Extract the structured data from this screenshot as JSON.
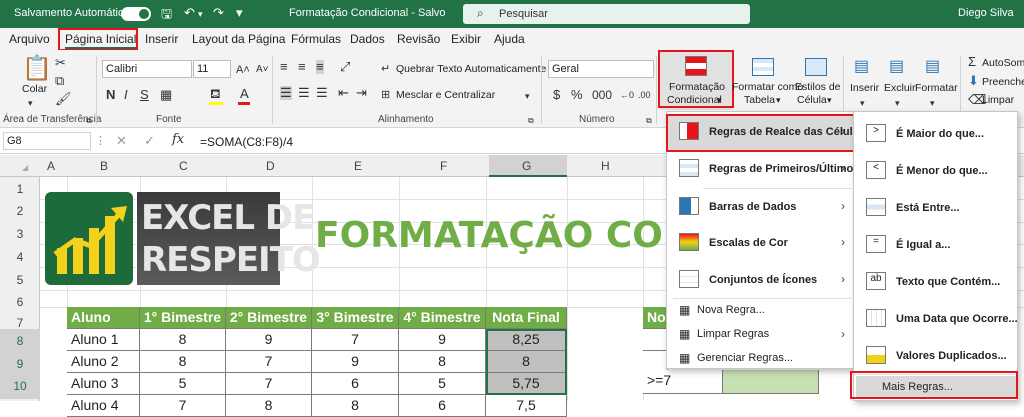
{
  "titlebar": {
    "autosave": "Salvamento Automático",
    "title": "Formatação Condicional  -  Salvo",
    "search_placeholder": "Pesquisar",
    "user": "Diego Silva"
  },
  "menu": [
    "Arquivo",
    "Página Inicial",
    "Inserir",
    "Layout da Página",
    "Fórmulas",
    "Dados",
    "Revisão",
    "Exibir",
    "Ajuda"
  ],
  "ribbon": {
    "paste": "Colar",
    "clipboard": "Área de Transferência",
    "font_name": "Calibri",
    "font_size": "11",
    "font_group": "Fonte",
    "wrap": "Quebrar Texto Automaticamente",
    "merge": "Mesclar e Centralizar",
    "alignment": "Alinhamento",
    "number_format": "Geral",
    "number_group": "Número",
    "cond_format_1": "Formatação",
    "cond_format_2": "Condicional",
    "format_table_1": "Formatar como",
    "format_table_2": "Tabela",
    "cell_styles_1": "Estilos de",
    "cell_styles_2": "Célula",
    "insert": "Inserir",
    "delete": "Excluir",
    "format": "Formatar",
    "autosum": "AutoSoma",
    "fill": "Preencher",
    "clear": "Limpar"
  },
  "formula": {
    "namebox": "G8",
    "fx": "fx",
    "value": "=SOMA(C8:F8)/4"
  },
  "columns": [
    "A",
    "B",
    "C",
    "D",
    "E",
    "F",
    "G",
    "H"
  ],
  "rows": [
    "1",
    "2",
    "3",
    "4",
    "5",
    "6",
    "7",
    "8",
    "9",
    "10"
  ],
  "logo": {
    "line1": "EXCEL DE",
    "line2": "RESPEITO"
  },
  "sheet_title": "FORMATAÇÃO COND",
  "table": {
    "headers": [
      "Aluno",
      "1° Bimestre",
      "2° Bimestre",
      "3° Bimestre",
      "4° Bimestre",
      "Nota Final"
    ],
    "rows": [
      [
        "Aluno 1",
        "8",
        "9",
        "7",
        "9",
        "8,25"
      ],
      [
        "Aluno 2",
        "8",
        "7",
        "9",
        "8",
        "8"
      ],
      [
        "Aluno 3",
        "5",
        "7",
        "6",
        "5",
        "5,75"
      ],
      [
        "Aluno 4",
        "7",
        "8",
        "8",
        "6",
        "7,5"
      ]
    ]
  },
  "side_table": {
    "header": "No",
    "cell": ">=7"
  },
  "cond_menu": [
    {
      "label": "Regras de Realce das Células",
      "bold": true,
      "arrow": true
    },
    {
      "label": "Regras de Primeiros/Últimos",
      "bold": true,
      "arrow": true
    },
    {
      "label": "Barras de Dados",
      "bold": true,
      "arrow": true
    },
    {
      "label": "Escalas de Cor",
      "bold": true,
      "arrow": true
    },
    {
      "label": "Conjuntos de Ícones",
      "bold": true,
      "arrow": true
    },
    {
      "label": "Nova Regra...",
      "bold": false,
      "arrow": false
    },
    {
      "label": "Limpar Regras",
      "bold": false,
      "arrow": true
    },
    {
      "label": "Gerenciar Regras...",
      "bold": false,
      "arrow": false
    }
  ],
  "sub_menu": [
    "É Maior do que...",
    "É Menor do que...",
    "Está Entre...",
    "É Igual a...",
    "Texto que Contém...",
    "Uma Data que Ocorre...",
    "Valores Duplicados..."
  ],
  "more_rules": "Mais Regras...",
  "colors": {
    "excel_green": "#217346",
    "header_green": "#70ad47",
    "highlight_red": "#e8141b"
  }
}
